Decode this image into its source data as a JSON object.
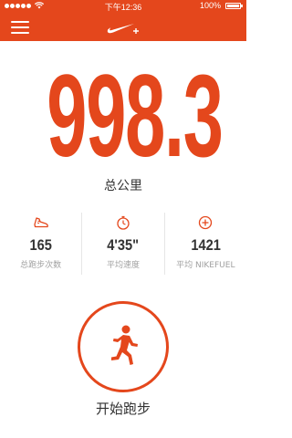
{
  "status_bar": {
    "time": "下午12:36",
    "battery_text": "100%",
    "battery_level": 1.0
  },
  "nav": {
    "menu_icon": "hamburger-menu-icon",
    "logo_icon": "nike-plus-swoosh-icon"
  },
  "summary": {
    "total_distance": "998.3",
    "total_distance_label": "总公里"
  },
  "stats": [
    {
      "icon": "running-shoe-icon",
      "value": "165",
      "label": "总跑步次数"
    },
    {
      "icon": "stopwatch-icon",
      "value": "4'35\"",
      "label": "平均速度"
    },
    {
      "icon": "nikefuel-plus-icon",
      "value": "1421",
      "label": "平均 NIKEFUEL"
    }
  ],
  "run_button": {
    "icon": "runner-icon",
    "label": "开始跑步"
  },
  "colors": {
    "accent": "#e4471c",
    "text": "#333333",
    "muted": "#a0a0a0"
  }
}
